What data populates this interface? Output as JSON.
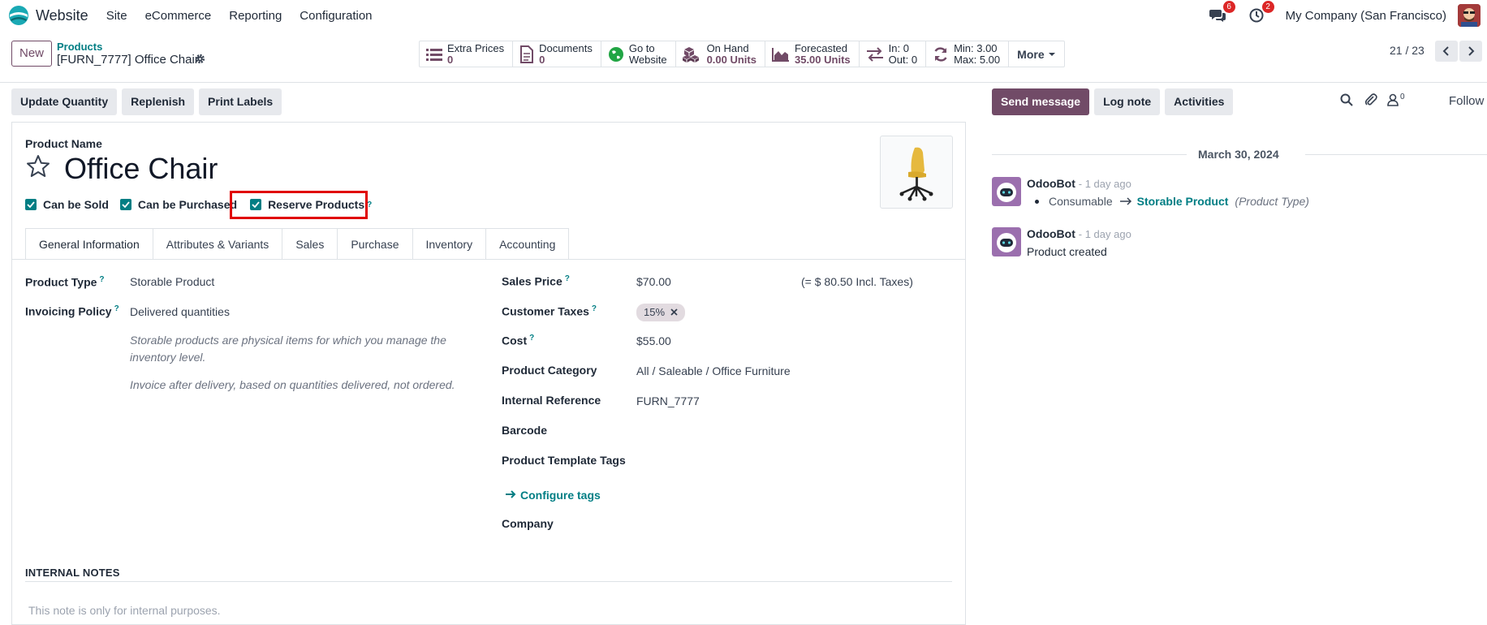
{
  "topbar": {
    "app_name": "Website",
    "menu": [
      "Site",
      "eCommerce",
      "Reporting",
      "Configuration"
    ],
    "messages_count": "6",
    "activities_count": "2",
    "company": "My Company (San Francisco)"
  },
  "control": {
    "new_label": "New",
    "breadcrumb_parent": "Products",
    "breadcrumb_current": "[FURN_7777] Office Chair",
    "smart_buttons": [
      {
        "title": "Extra Prices",
        "value": "0",
        "icon": "list-icon"
      },
      {
        "title": "Documents",
        "value": "0",
        "icon": "document-icon"
      },
      {
        "title": "Go to",
        "value": "Website",
        "icon": "globe-icon"
      },
      {
        "title": "On Hand",
        "value": "0.00 Units",
        "icon": "cubes-icon"
      },
      {
        "title": "Forecasted",
        "value": "35.00 Units",
        "icon": "area-chart-icon"
      },
      {
        "title": "In: 0",
        "value": "Out: 0",
        "icon": "exchange-icon"
      },
      {
        "title": "Min: 3.00",
        "value": "Max: 5.00",
        "icon": "refresh-icon"
      }
    ],
    "more_label": "More",
    "pager": "21 / 23"
  },
  "actions": [
    "Update Quantity",
    "Replenish",
    "Print Labels"
  ],
  "form": {
    "product_name_label": "Product Name",
    "product_name": "Office Chair",
    "checks": {
      "can_be_sold": "Can be Sold",
      "can_be_purchased": "Can be Purchased",
      "reserve_products": "Reserve Products"
    },
    "tooltip_mark": "?",
    "tabs": [
      "General Information",
      "Attributes & Variants",
      "Sales",
      "Purchase",
      "Inventory",
      "Accounting"
    ],
    "left": {
      "product_type_label": "Product Type",
      "product_type": "Storable Product",
      "invoicing_policy_label": "Invoicing Policy",
      "invoicing_policy": "Delivered quantities",
      "help_storable": "Storable products are physical items for which you manage the inventory level.",
      "help_invoice": "Invoice after delivery, based on quantities delivered, not ordered."
    },
    "right": {
      "sales_price_label": "Sales Price",
      "sales_price": "$70.00",
      "incl_taxes": "(= $ 80.50 Incl. Taxes)",
      "customer_taxes_label": "Customer Taxes",
      "customer_tax_tag": "15%",
      "cost_label": "Cost",
      "cost": "$55.00",
      "category_label": "Product Category",
      "category": "All / Saleable / Office Furniture",
      "internal_ref_label": "Internal Reference",
      "internal_ref": "FURN_7777",
      "barcode_label": "Barcode",
      "template_tags_label": "Product Template Tags",
      "configure_tags": "Configure tags",
      "company_label": "Company"
    },
    "notes_title": "INTERNAL NOTES",
    "notes_placeholder": "This note is only for internal purposes."
  },
  "chatter": {
    "send_message": "Send message",
    "log_note": "Log note",
    "activities": "Activities",
    "followers_count": "0",
    "follow": "Follow",
    "date": "March 30, 2024",
    "messages": [
      {
        "author": "OdooBot",
        "ago": "- 1 day ago",
        "old": "Consumable",
        "new": "Storable Product",
        "field": "(Product Type)"
      },
      {
        "author": "OdooBot",
        "ago": "- 1 day ago",
        "body": "Product created"
      }
    ]
  },
  "colors": {
    "primary": "#714b67",
    "teal": "#017e84",
    "highlight": "#e00000"
  }
}
